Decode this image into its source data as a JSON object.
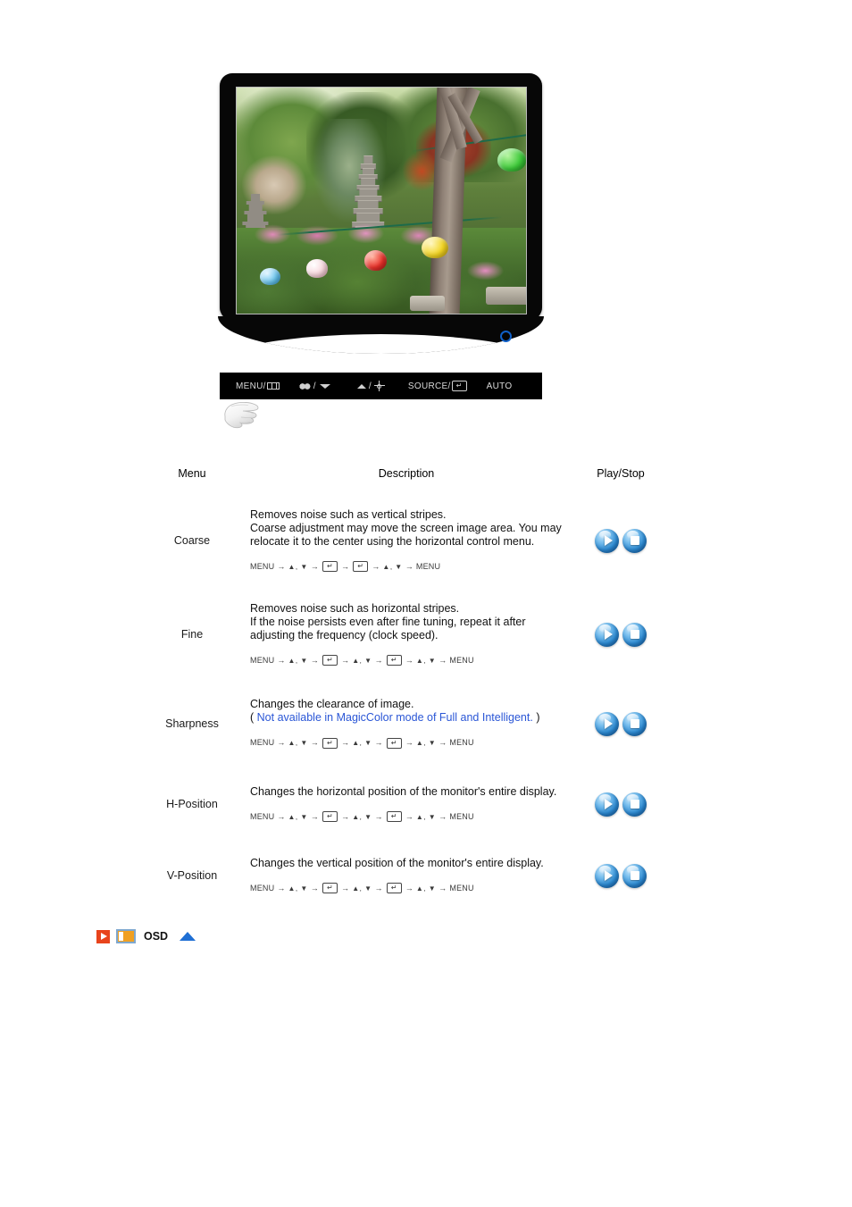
{
  "monitor": {
    "photo_alt": "korean-temple-garden-with-stone-pagoda-and-paper-lanterns",
    "power_led": "blue-power-indicator"
  },
  "control_bar": {
    "buttons": [
      {
        "label": "MENU/",
        "icon": "osd-window-icon"
      },
      {
        "label": "/",
        "icon_left": "magic-color-icon",
        "icon_right": "down-arrow-icon"
      },
      {
        "label": "/",
        "icon_left": "up-arrow-icon",
        "icon_right": "brightness-icon"
      },
      {
        "label": "SOURCE/",
        "icon": "enter-key-icon"
      },
      {
        "label": "AUTO",
        "icon": ""
      }
    ],
    "menu_text": "MENU/",
    "source_text": "SOURCE/",
    "auto_text": "AUTO",
    "enter_glyph": "↵"
  },
  "table": {
    "headers": {
      "menu": "Menu",
      "description": "Description",
      "play_stop": "Play/Stop"
    },
    "rows": [
      {
        "menu": "Coarse",
        "desc_lines": [
          "Removes noise such as vertical stripes.",
          "Coarse adjustment may move the screen image area. You may relocate it to the center using the horizontal control menu."
        ],
        "note_prefix": "",
        "note_blue": "",
        "note_suffix": "",
        "keyseq": [
          "MENU",
          "▲, ▼",
          "ENTER",
          "ENTER",
          "▲, ▼",
          "MENU"
        ]
      },
      {
        "menu": "Fine",
        "desc_lines": [
          "Removes noise such as horizontal stripes.",
          "If the noise persists even after fine tuning, repeat it after adjusting the frequency (clock speed)."
        ],
        "note_prefix": "",
        "note_blue": "",
        "note_suffix": "",
        "keyseq": [
          "MENU",
          "▲, ▼",
          "ENTER",
          "▲, ▼",
          "ENTER",
          "▲, ▼",
          "MENU"
        ]
      },
      {
        "menu": "Sharpness",
        "desc_lines": [
          "Changes the clearance of image."
        ],
        "note_prefix": "( ",
        "note_blue": "Not available in MagicColor mode of Full and Intelligent.",
        "note_suffix": " )",
        "keyseq": [
          "MENU",
          "▲, ▼",
          "ENTER",
          "▲, ▼",
          "ENTER",
          "▲, ▼",
          "MENU"
        ]
      },
      {
        "menu": "H-Position",
        "desc_lines": [
          "Changes the horizontal position of the monitor's entire display."
        ],
        "note_prefix": "",
        "note_blue": "",
        "note_suffix": "",
        "keyseq": [
          "MENU",
          "▲, ▼",
          "ENTER",
          "▲, ▼",
          "ENTER",
          "▲, ▼",
          "MENU"
        ]
      },
      {
        "menu": "V-Position",
        "desc_lines": [
          "Changes the vertical position of the monitor's entire display."
        ],
        "note_prefix": "",
        "note_blue": "",
        "note_suffix": "",
        "keyseq": [
          "MENU",
          "▲, ▼",
          "ENTER",
          "▲, ▼",
          "ENTER",
          "▲, ▼",
          "MENU"
        ]
      }
    ],
    "play_button": "play-button",
    "stop_button": "stop-button"
  },
  "footer": {
    "label": "OSD",
    "play_icon": "red-play-icon",
    "monitor_icon": "monitor-thumbnail-icon",
    "top_icon": "back-to-top-icon"
  },
  "colors": {
    "note_blue": "#2a56d6",
    "orb_blue": "#2f8fd8",
    "footer_red": "#e8441c",
    "footer_orange": "#f0a022",
    "footer_top_blue": "#1f6fd4",
    "led_blue": "#1060c8"
  }
}
